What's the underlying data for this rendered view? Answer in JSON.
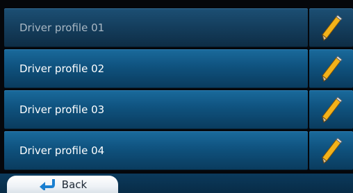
{
  "profiles": [
    {
      "label": "Driver profile 01",
      "selected": true
    },
    {
      "label": "Driver profile 02",
      "selected": false
    },
    {
      "label": "Driver profile 03",
      "selected": false
    },
    {
      "label": "Driver profile 04",
      "selected": false
    }
  ],
  "icons": {
    "edit": "pencil-icon",
    "back": "back-arrow-icon"
  },
  "footer": {
    "back_label": "Back"
  },
  "colors": {
    "row": "#0f527e",
    "row_selected": "#143d5c",
    "pencil_body": "#f2b21a",
    "back_arrow": "#1a7fd0"
  }
}
